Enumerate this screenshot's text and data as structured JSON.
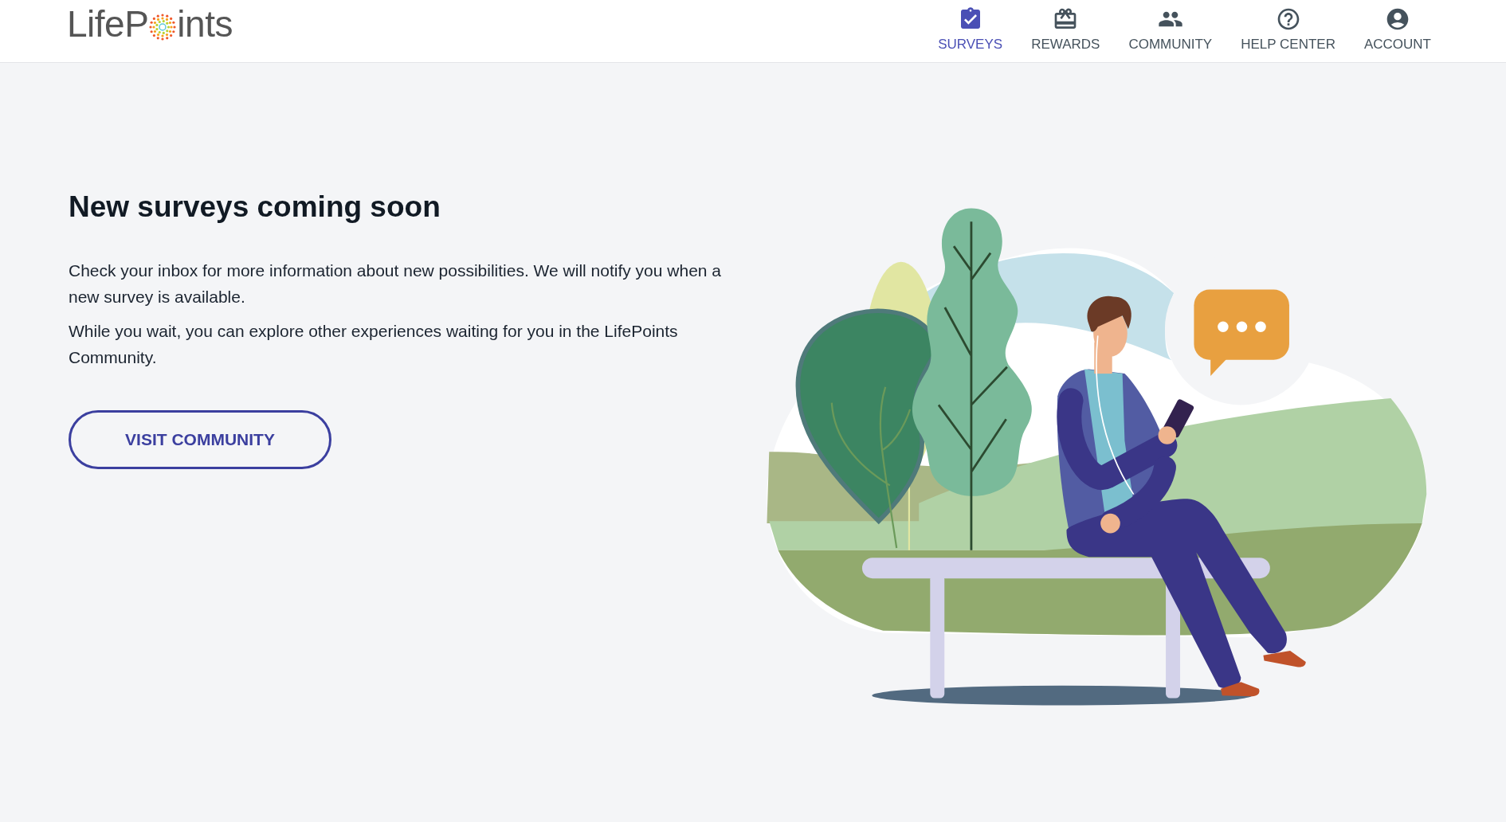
{
  "logo": {
    "start": "LifeP",
    "end": "ints"
  },
  "nav": [
    {
      "label": "SURVEYS",
      "kind": "surveys",
      "selected": true
    },
    {
      "label": "REWARDS",
      "kind": "rewards",
      "selected": false
    },
    {
      "label": "COMMUNITY",
      "kind": "community",
      "selected": false
    },
    {
      "label": "HELP CENTER",
      "kind": "help",
      "selected": false
    },
    {
      "label": "ACCOUNT",
      "kind": "account",
      "selected": false
    }
  ],
  "heading": "New surveys coming soon",
  "paragraphs": [
    "Check your inbox for more information about new possibilities. We will notify you when a new survey is available.",
    "While you wait, you can explore other experiences waiting for you in the LifePoints Community."
  ],
  "button": "VISIT COMMUNITY"
}
